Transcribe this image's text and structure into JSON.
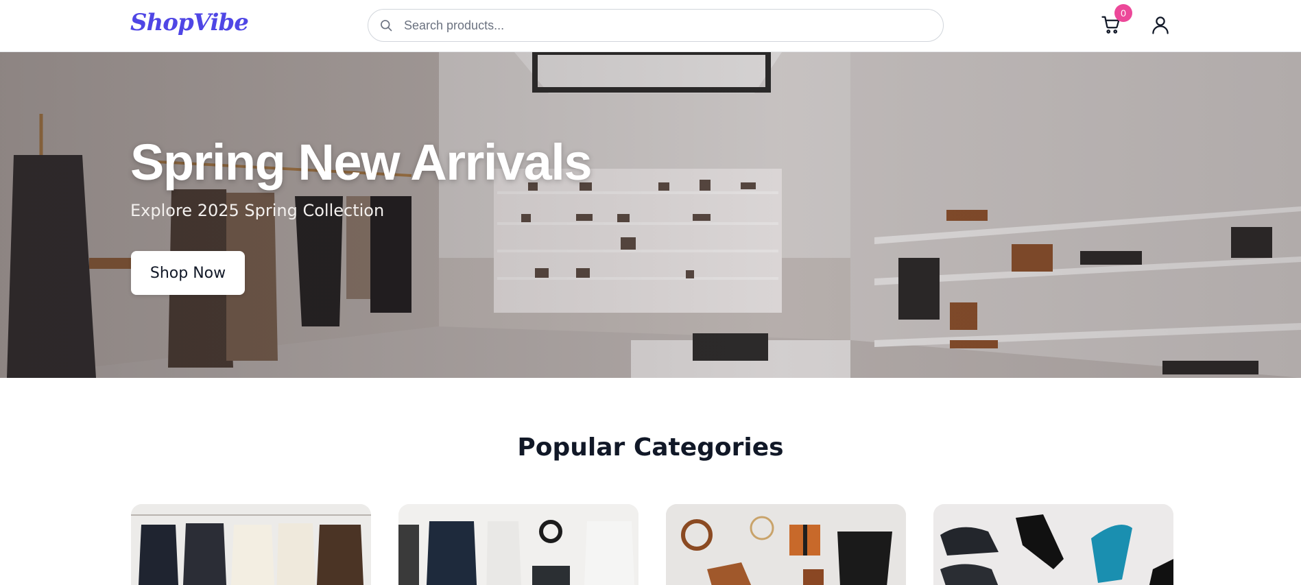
{
  "header": {
    "logo": "ShopVibe",
    "search_placeholder": "Search products...",
    "cart_count": "0",
    "icons": [
      "search-icon",
      "cart-icon",
      "user-icon"
    ]
  },
  "hero": {
    "title": "Spring New Arrivals",
    "subtitle": "Explore 2025 Spring Collection",
    "cta_label": "Shop Now"
  },
  "categories": {
    "heading": "Popular Categories"
  },
  "colors": {
    "brand": "#4f46e5",
    "badge": "#ec4899",
    "text": "#111827"
  }
}
